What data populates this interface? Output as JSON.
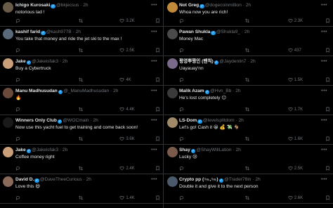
{
  "left": [
    {
      "name": "Ichigo Kurosaki",
      "handle": "@bkjecsus",
      "time": "2h",
      "text": "notorious lad !",
      "likes": "3.2K",
      "avatar_color": "#6a5a4a"
    },
    {
      "name": "kashif farid",
      "handle": "@kash977B",
      "time": "2h",
      "text": "You take that money and ride the jet ski to the max !",
      "likes": "2.5K",
      "avatar_color": "#5a6a7a"
    },
    {
      "name": "Jake",
      "handle": "@Jakeisfak3",
      "time": "2h",
      "text": "Buy a Cybertruck",
      "likes": "4K",
      "avatar_color": "#c9a07a"
    },
    {
      "name": "Manu Madhusudan",
      "handle": "@_ManuMadhusudan",
      "time": "2h",
      "text": "🔥",
      "likes": "4.4K",
      "avatar_color": "#6a4a3a"
    },
    {
      "name": "Winners Only Club",
      "handle": "@WOCmain",
      "time": "2h",
      "text": "Now use this yacht fuel to get training and come back soon!",
      "likes": "3.6K",
      "avatar_color": "#1a1a1a"
    },
    {
      "name": "Jake",
      "handle": "@Jakeisfak3",
      "time": "2h",
      "text": "Coffee money right",
      "likes": "2.4K",
      "avatar_color": "#c9a07a"
    },
    {
      "name": "David D.",
      "handle": "@DaveTheeCurious",
      "time": "2h",
      "text": "Love this 😄",
      "likes": "1.4K",
      "avatar_color": "#8a6a5a"
    }
  ],
  "right": [
    {
      "name": "Not Greg",
      "handle": "@dogecoinmillion",
      "time": "2h",
      "text": "Whoa now you are rich!",
      "likes": "2.3K",
      "avatar_color": "#c08a3a"
    },
    {
      "name": "Pawan Shukla",
      "handle": "@Shukla9_",
      "time": "2h",
      "text": "Money Mac",
      "likes": "437",
      "avatar_color": "#4a4a4a"
    },
    {
      "name": "평영뿌짱인 (팬칙)",
      "handle": "@Jaydenlin7",
      "time": "2h",
      "text": "Uayauay'nn",
      "likes": "1.5K",
      "avatar_color": "#7a6a8a"
    },
    {
      "name": "Malik Azam",
      "handle": "@Hvn_Bb",
      "time": "2h",
      "text": "He's lost completely 😑",
      "likes": "1.7K",
      "avatar_color": "#3a3a3a"
    },
    {
      "name": "LS-Dom",
      "handle": "@levelsplitdom",
      "time": "2h",
      "text": "Let's go! Cash it 😀 💰 💸 🐐",
      "likes": "1.6K",
      "avatar_color": "#a08a6a"
    },
    {
      "name": "Shay",
      "handle": "@ShayWillLation",
      "time": "2h",
      "text": "Lucky 😢",
      "likes": "2.5K",
      "avatar_color": "#7a5a4a"
    },
    {
      "name": "Crypto pp (🐜,🐜)",
      "handle": "@Trader78in",
      "time": "2h",
      "text": "Double it and give it to the next person",
      "likes": "2.6K",
      "avatar_color": "#4a5a6a"
    }
  ]
}
